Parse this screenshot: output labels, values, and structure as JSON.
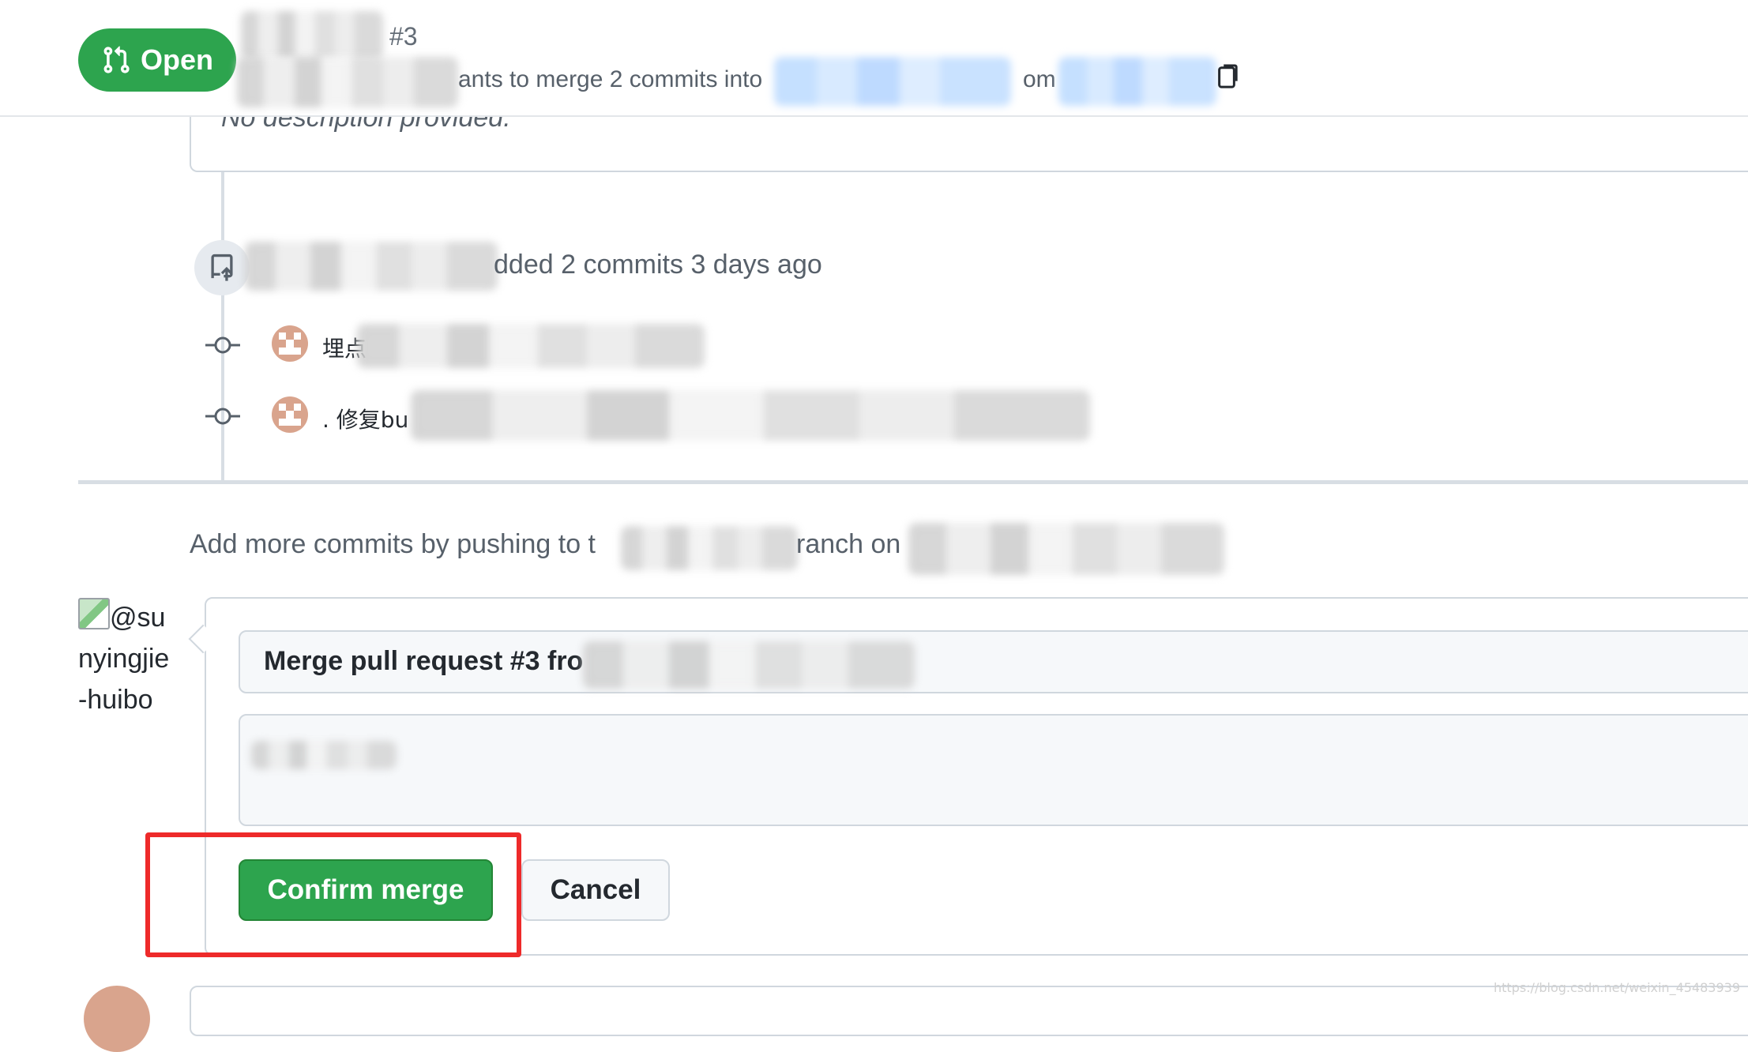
{
  "header": {
    "status_label": "Open",
    "pr_number": "#3",
    "merge_summary_part1": "ants to merge 2 commits into",
    "merge_summary_part2": "om"
  },
  "description": {
    "text": "No description provided."
  },
  "timeline": {
    "push_event_text": "dded 2 commits 3 days ago",
    "commits": [
      {
        "message": "埋点"
      },
      {
        "message": ". 修复bu"
      }
    ]
  },
  "merge_section": {
    "hint_part1": "Add more commits by pushing to t",
    "hint_part2": "ranch on",
    "user_alt_text": "@sunyingjie-huibo",
    "commit_title_value": "Merge pull request #3 fro",
    "confirm_label": "Confirm merge",
    "cancel_label": "Cancel"
  },
  "watermark": "https://blog.csdn.net/weixin_45483939",
  "colors": {
    "open_green": "#2da44e",
    "highlight_red": "#ee2a2a",
    "link_blue": "#0969da"
  }
}
